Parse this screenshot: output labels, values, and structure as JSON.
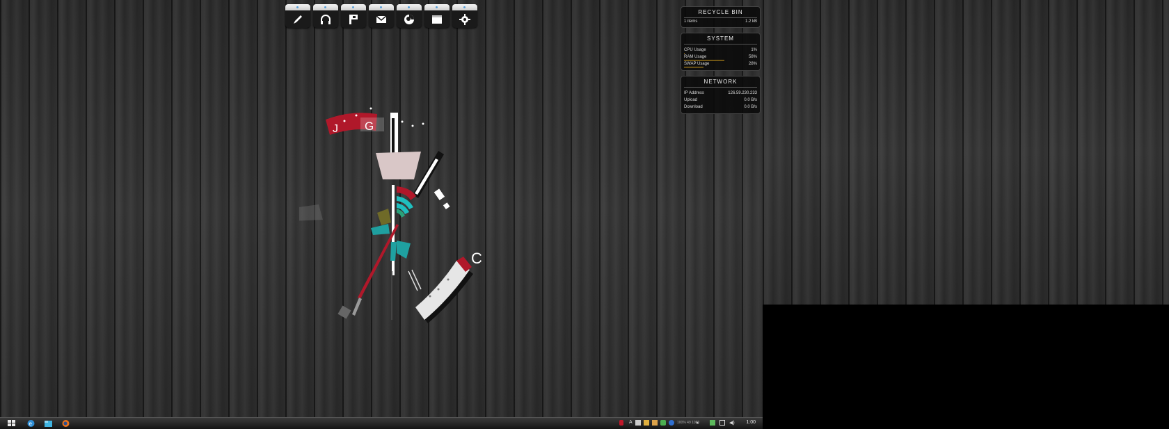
{
  "dock": {
    "items": [
      {
        "name": "pen-icon"
      },
      {
        "name": "headphones-icon"
      },
      {
        "name": "flag-icon"
      },
      {
        "name": "mail-icon"
      },
      {
        "name": "firefox-icon"
      },
      {
        "name": "window-icon"
      },
      {
        "name": "settings-gear-icon"
      }
    ]
  },
  "recycle_bin": {
    "title": "RECYCLE BIN",
    "items": "1 items",
    "size": "1.2 kB"
  },
  "system": {
    "title": "SYSTEM",
    "cpu_label": "CPU Usage",
    "cpu_value": "1%",
    "ram_label": "RAM Usage",
    "ram_value": "58%",
    "swap_label": "SWAP Usage",
    "swap_value": "28%",
    "cpu_fraction": 0.01,
    "ram_fraction": 0.58,
    "swap_fraction": 0.28,
    "bar_color": "#d9a21b"
  },
  "network": {
    "title": "NETWORK",
    "ip_label": "IP Address",
    "ip_value": "126.59.230.233",
    "upload_label": "Upload",
    "upload_value": "0.0 B/s",
    "download_label": "Download",
    "download_value": "0.0 B/s"
  },
  "clock_widget": {
    "letters": [
      "J",
      "G",
      "C"
    ],
    "accent": "#b0182a",
    "secondary": "#1fbfbf"
  },
  "taskbar": {
    "clock": "1:00",
    "tray_text": "100% 49 1080",
    "apps": [
      "start-button",
      "ie-icon",
      "explorer-icon",
      "firefox-icon"
    ]
  }
}
